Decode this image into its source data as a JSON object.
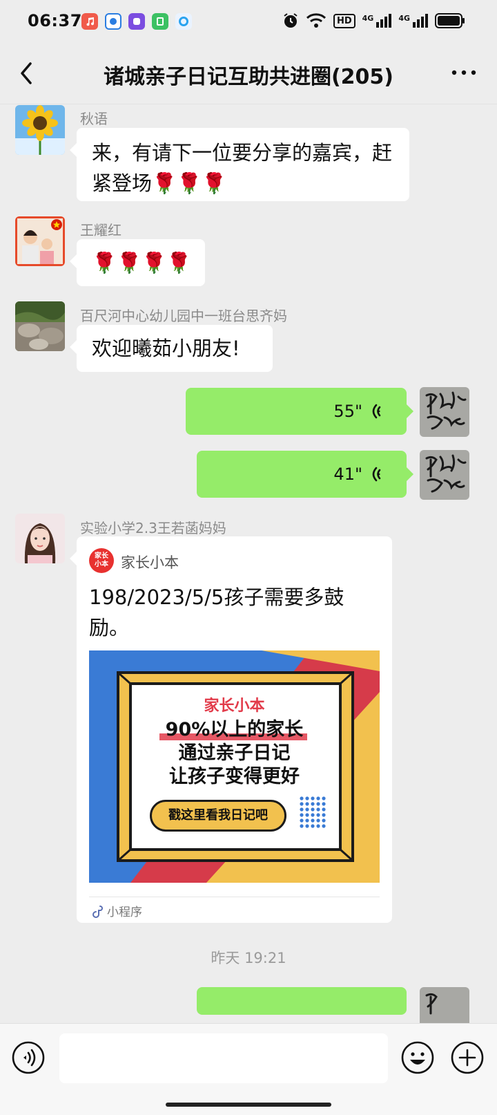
{
  "status_bar": {
    "time": "06:37",
    "hd_label": "HD",
    "network_1": "4G",
    "network_2": "4G"
  },
  "header": {
    "title": "诸城亲子日记互助共进圈(205)"
  },
  "messages": [
    {
      "sender": "秋语",
      "text_line1": "来，有请下一位要分享的嘉宾，赶",
      "text_line2": "紧登场🌹🌹🌹"
    },
    {
      "sender": "王耀红",
      "text": "🌹🌹🌹🌹"
    },
    {
      "sender": "百尺河中心幼儿园中一班台思齐妈",
      "text": "欢迎曦茹小朋友!"
    },
    {
      "voice_1_duration": "55\"",
      "voice_2_duration": "41\""
    },
    {
      "sender": "实验小学2.3王若菡妈妈"
    }
  ],
  "miniprogram": {
    "app_name": "家长小本",
    "logo_text_1": "家长",
    "logo_text_2": "小本",
    "title_line1": "198/2023/5/5孩子需要多鼓",
    "title_line2": "励。",
    "poster_brand": "家长小本",
    "poster_line1": "90%以上的家长",
    "poster_line2": "通过亲子日记",
    "poster_line3": "让孩子变得更好",
    "poster_button": "戳这里看我日记吧",
    "footer_label": "小程序"
  },
  "timestamp": "昨天 19:21",
  "colors": {
    "background": "#ededed",
    "self_bubble": "#95ec69",
    "other_bubble": "#ffffff",
    "poster_blue": "#3a7bd5",
    "poster_red": "#d63b4a",
    "poster_yellow": "#f2c14e"
  }
}
